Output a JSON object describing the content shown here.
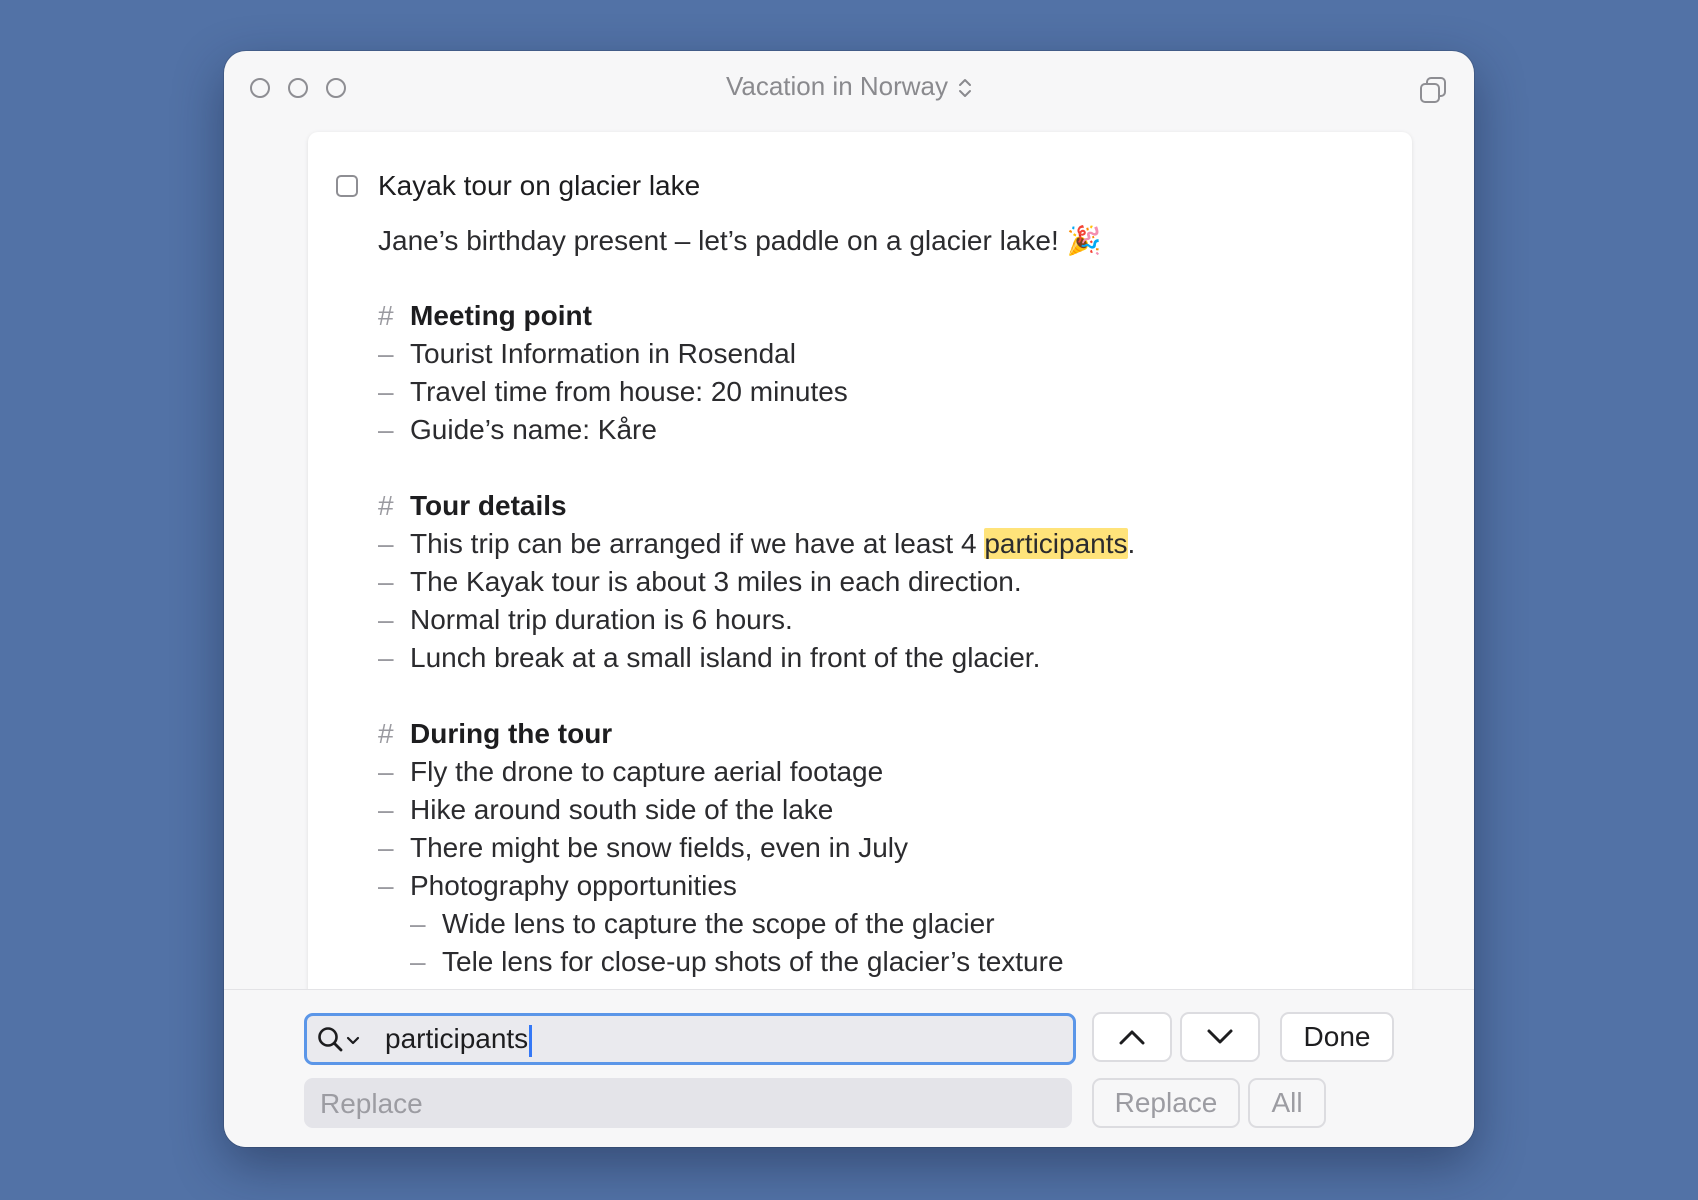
{
  "window": {
    "title": "Vacation in Norway"
  },
  "task": {
    "title": "Kayak tour on glacier lake",
    "note": "Jane’s birthday present – let’s paddle on a glacier lake! 🎉"
  },
  "sections": [
    {
      "heading": "Meeting point",
      "items": [
        "Tourist Information in Rosendal",
        "Travel time from house: 20 minutes",
        "Guide’s name: Kåre"
      ]
    },
    {
      "heading": "Tour details",
      "items": [
        "This trip can be arranged if we have at least 4 ",
        "The Kayak tour is about 3 miles in each direction.",
        "Normal trip duration is 6 hours.",
        "Lunch break at a small island in front of the glacier."
      ],
      "highlight": "participants",
      "after_highlight": "."
    },
    {
      "heading": "During the tour",
      "items": [
        "Fly the drone to capture aerial footage",
        "Hike around south side of the lake",
        "There might be snow fields, even in July",
        "Photography opportunities"
      ],
      "subitems": [
        "Wide lens to capture the scope of the glacier",
        "Tele lens for close-up shots of the glacier’s texture"
      ]
    }
  ],
  "markers": {
    "heading": "#",
    "bullet": "–"
  },
  "find": {
    "query": "participants",
    "replace_placeholder": "Replace",
    "done_label": "Done",
    "replace_label": "Replace",
    "all_label": "All"
  },
  "colors": {
    "background": "#5272a6",
    "highlight": "#ffe37a",
    "focus": "#5b96e8"
  }
}
